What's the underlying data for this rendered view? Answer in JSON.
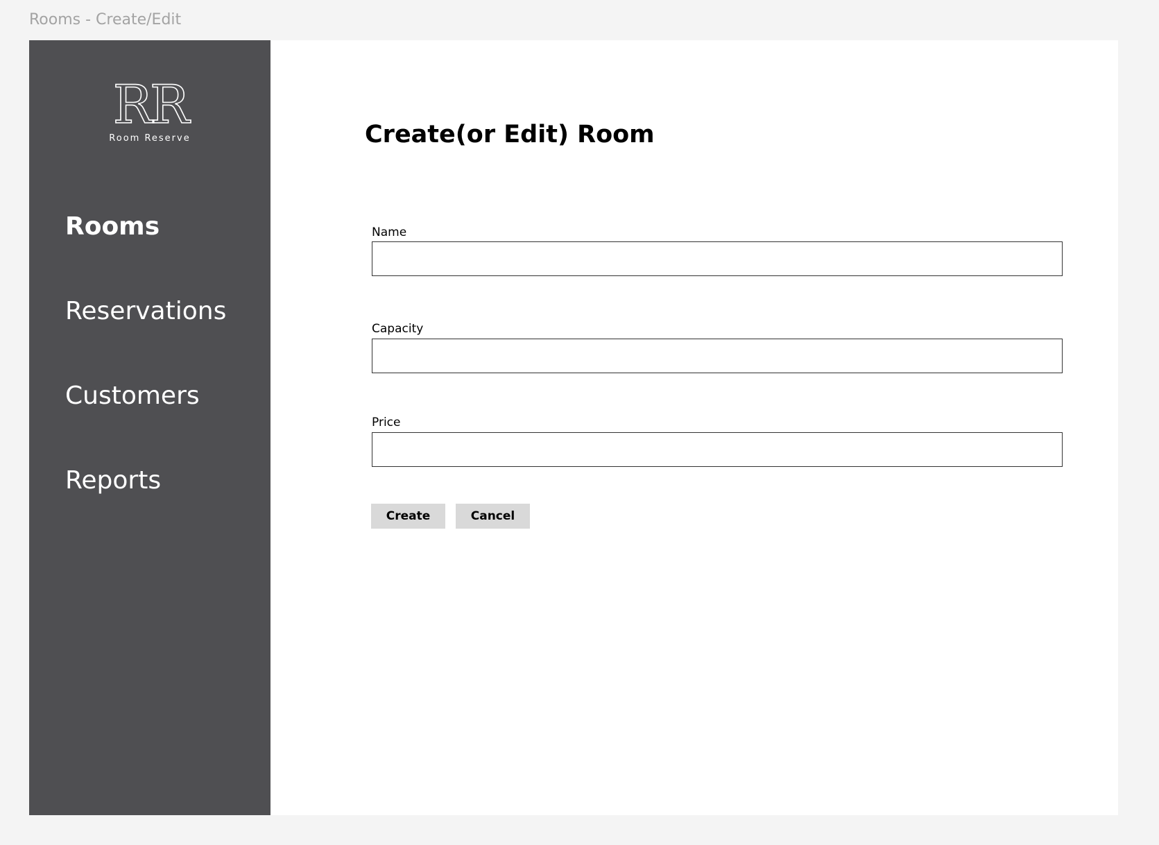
{
  "frame": {
    "label": "Rooms - Create/Edit"
  },
  "sidebar": {
    "logo": {
      "mark": "RR",
      "text": "Room Reserve"
    },
    "items": [
      {
        "label": "Rooms",
        "active": true
      },
      {
        "label": "Reservations",
        "active": false
      },
      {
        "label": "Customers",
        "active": false
      },
      {
        "label": "Reports",
        "active": false
      }
    ]
  },
  "main": {
    "title": "Create(or Edit) Room",
    "fields": [
      {
        "label": "Name",
        "value": ""
      },
      {
        "label": "Capacity",
        "value": ""
      },
      {
        "label": "Price",
        "value": ""
      }
    ],
    "buttons": {
      "create": "Create",
      "cancel": "Cancel"
    }
  },
  "colors": {
    "sidebar_bg": "#4f4f52",
    "page_bg": "#f4f4f4",
    "button_bg": "#d9d9d9",
    "frame_label": "#a3a3a3"
  }
}
